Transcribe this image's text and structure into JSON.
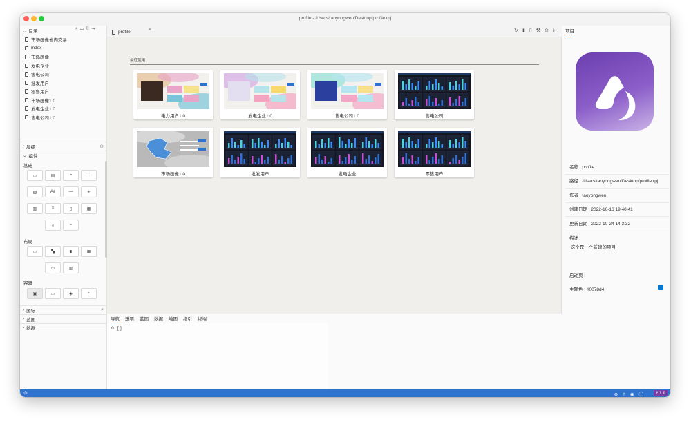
{
  "window": {
    "title": "profile - /Users/taoyongwen/Desktop/profile.rpj"
  },
  "sidebar": {
    "header_label": "目录",
    "header_icons": [
      "search-icon",
      "folder-icon",
      "file-icon",
      "login-icon"
    ],
    "files": [
      "市场画像省内交易",
      "index",
      "市场画像",
      "发电企业",
      "售电公司",
      "批发用户",
      "零售用户",
      "市场画像1.0",
      "发电企业1.0",
      "售电公司1.0"
    ],
    "sections": {
      "hierarchy": "层级",
      "components": "组件",
      "icons": "图标",
      "blueprint": "蓝图",
      "data": "数据"
    },
    "groups": {
      "basic": "基础",
      "layout": "布局",
      "container": "容器"
    },
    "basic_buttons": [
      "▭",
      "▤",
      "◔",
      "⇔",
      "▨",
      "Aa",
      "—",
      "⁜",
      "▥",
      "≡",
      "▯",
      "▦",
      "⇕",
      "≈"
    ],
    "layout_buttons": [
      "▭",
      "▚",
      "▮",
      "▦",
      "▭",
      "▥"
    ],
    "container_buttons": [
      "▣",
      "▭",
      "◈",
      "▪"
    ]
  },
  "editor": {
    "tab_label": "profile",
    "toolbar_icons": [
      "refresh-icon",
      "mobile-icon",
      "page-icon",
      "hammer-icon",
      "play-icon",
      "download-icon"
    ],
    "recent_label": "最近使用",
    "cards": [
      {
        "label": "电力用户1.0",
        "theme": "light"
      },
      {
        "label": "发电企业1.0",
        "theme": "light"
      },
      {
        "label": "售电公司1.0",
        "theme": "light"
      },
      {
        "label": "售电公司",
        "theme": "dark"
      },
      {
        "label": "市场画像1.0",
        "theme": "map"
      },
      {
        "label": "批发用户",
        "theme": "dark"
      },
      {
        "label": "发电企业",
        "theme": "dark"
      },
      {
        "label": "零售用户",
        "theme": "dark"
      }
    ]
  },
  "bottom": {
    "tabs": [
      "导航",
      "选项",
      "蓝图",
      "数据",
      "地图",
      "指引",
      "终端"
    ],
    "console_line": "0  []"
  },
  "right": {
    "tab_label": "项目",
    "name": "名称 : profile",
    "path": "路径 : /Users/taoyongwen/Desktop/profile.rpj",
    "author": "作者 : taoyongwen",
    "created": "创建日期 : 2022-10-16 19:40:41",
    "updated": "更新日期 : 2022-10-24 14:3:32",
    "desc_label": "描述 :",
    "desc_value": "这个是一个新建的项目",
    "start_page": "启动页 :",
    "theme_color_label": "主题色 : #0078d4",
    "theme_color": "#0078d4"
  },
  "status": {
    "version": "2.1.0",
    "accent": "#2f73cc"
  }
}
